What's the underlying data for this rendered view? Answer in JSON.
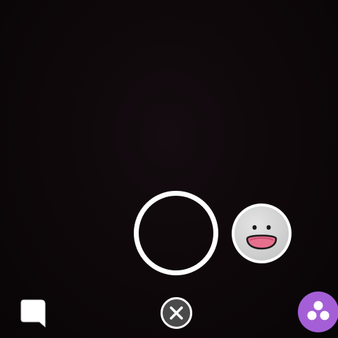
{
  "camera": {
    "capture_button": "capture-button",
    "lens_icon": "face-lens-icon",
    "chat_icon": "chat-icon",
    "close_icon": "close-icon",
    "memories_icon": "memories-icon"
  },
  "colors": {
    "background": "#0b0709",
    "capture_ring": "#ffffff",
    "lens_face": "#cfcfcf",
    "lens_mouth": "#e8708f",
    "close_circle": "#4a4a4a",
    "memories_accent": "#a45fd6"
  }
}
